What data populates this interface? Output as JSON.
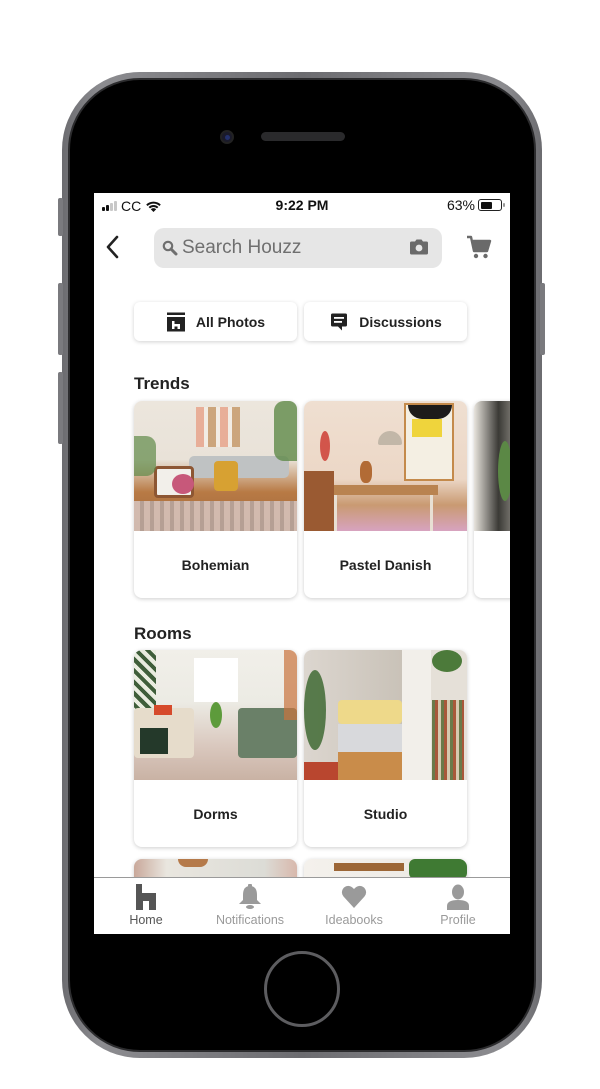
{
  "status_bar": {
    "carrier": "CC",
    "time": "9:22 PM",
    "battery_percent": "63%",
    "battery_level": 0.63,
    "signal_bars": 2
  },
  "nav": {
    "search_placeholder": "Search Houzz"
  },
  "quick_links": [
    {
      "label": "All Photos",
      "icon": "houzz-photos-icon"
    },
    {
      "label": "Discussions",
      "icon": "chat-bubble-icon"
    }
  ],
  "trends": {
    "title": "Trends",
    "cards": [
      {
        "label": "Bohemian"
      },
      {
        "label": "Pastel Danish"
      },
      {
        "label": ""
      }
    ]
  },
  "rooms": {
    "title": "Rooms",
    "cards": [
      {
        "label": "Dorms"
      },
      {
        "label": "Studio"
      }
    ]
  },
  "tabbar": {
    "items": [
      {
        "label": "Home",
        "icon": "houzz-home-icon",
        "active": true
      },
      {
        "label": "Notifications",
        "icon": "bell-icon",
        "active": false
      },
      {
        "label": "Ideabooks",
        "icon": "heart-icon",
        "active": false
      },
      {
        "label": "Profile",
        "icon": "person-icon",
        "active": false
      }
    ]
  },
  "colors": {
    "active_tab": "#555555",
    "inactive_tab": "#9a9a9a",
    "search_bg": "#e6e6e6"
  }
}
